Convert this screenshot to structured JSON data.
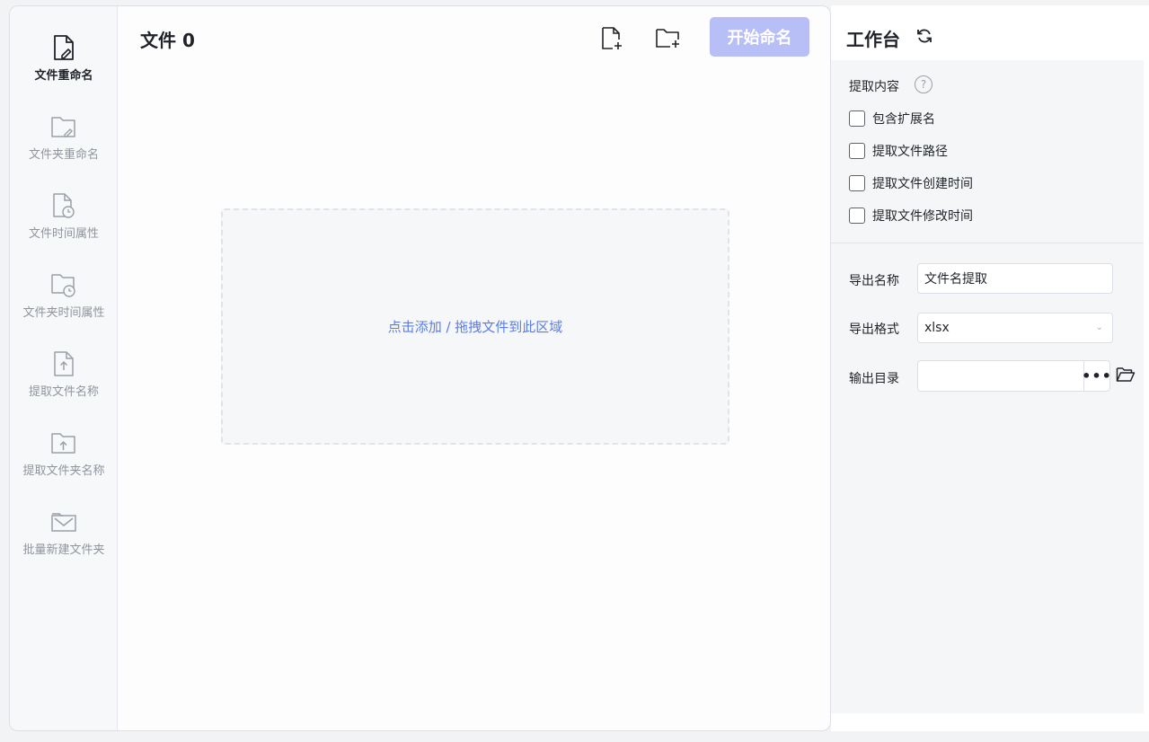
{
  "nav": {
    "items": [
      {
        "label": "文件重命名",
        "icon": "file-edit-icon",
        "active": true
      },
      {
        "label": "文件夹重命名",
        "icon": "folder-edit-icon",
        "active": false
      },
      {
        "label": "文件时间属性",
        "icon": "file-clock-icon",
        "active": false
      },
      {
        "label": "文件夹时间属性",
        "icon": "folder-clock-icon",
        "active": false
      },
      {
        "label": "提取文件名称",
        "icon": "file-upload-icon",
        "active": false
      },
      {
        "label": "提取文件夹名称",
        "icon": "folder-upload-icon",
        "active": false
      },
      {
        "label": "批量新建文件夹",
        "icon": "folder-mail-icon",
        "active": false
      }
    ]
  },
  "main": {
    "title": "文件 0",
    "add_file_icon": "file-plus-icon",
    "add_folder_icon": "folder-plus-icon",
    "start_button": "开始命名",
    "drop_zone_text": "点击添加 / 拖拽文件到此区域"
  },
  "workbench": {
    "title": "工作台",
    "refresh_icon": "refresh-icon",
    "extract_label": "提取内容",
    "help_icon": "?",
    "options": [
      {
        "label": "包含扩展名",
        "checked": false
      },
      {
        "label": "提取文件路径",
        "checked": false
      },
      {
        "label": "提取文件创建时间",
        "checked": false
      },
      {
        "label": "提取文件修改时间",
        "checked": false
      }
    ],
    "export_name_label": "导出名称",
    "export_name_value": "文件名提取",
    "export_format_label": "导出格式",
    "export_format_value": "xlsx",
    "output_dir_label": "输出目录",
    "output_dir_value": "",
    "browse_button": "•••"
  },
  "colors": {
    "accent_button": "#b8bff7",
    "drop_text": "#5b7de8"
  }
}
